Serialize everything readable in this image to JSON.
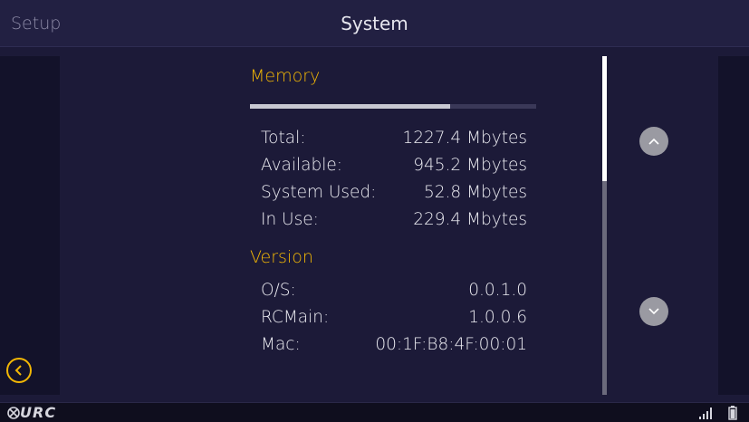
{
  "header": {
    "setup_label": "Setup",
    "title": "System"
  },
  "memory": {
    "heading": "Memory",
    "usage_fraction": 0.7,
    "rows": [
      {
        "label": "Total:",
        "value": "1227.4 Mbytes"
      },
      {
        "label": "Available:",
        "value": "945.2 Mbytes"
      },
      {
        "label": "System Used:",
        "value": "52.8 Mbytes"
      },
      {
        "label": "In Use:",
        "value": "229.4 Mbytes"
      }
    ]
  },
  "version": {
    "heading": "Version",
    "rows": [
      {
        "label": "O/S:",
        "value": "0.0.1.0"
      },
      {
        "label": "RCMain:",
        "value": "1.0.0.6"
      },
      {
        "label": "Mac:",
        "value": "00:1F:B8:4F:00:01"
      }
    ]
  },
  "footer": {
    "brand": "URC"
  },
  "icons": {
    "back": "chevron-left-icon",
    "scroll_up": "chevron-up-icon",
    "scroll_down": "chevron-down-icon",
    "signal": "signal-icon",
    "battery": "battery-icon"
  },
  "colors": {
    "accent": "#f2b705",
    "background": "#1c1a38",
    "header": "#222042",
    "side_panel": "#13122a"
  }
}
